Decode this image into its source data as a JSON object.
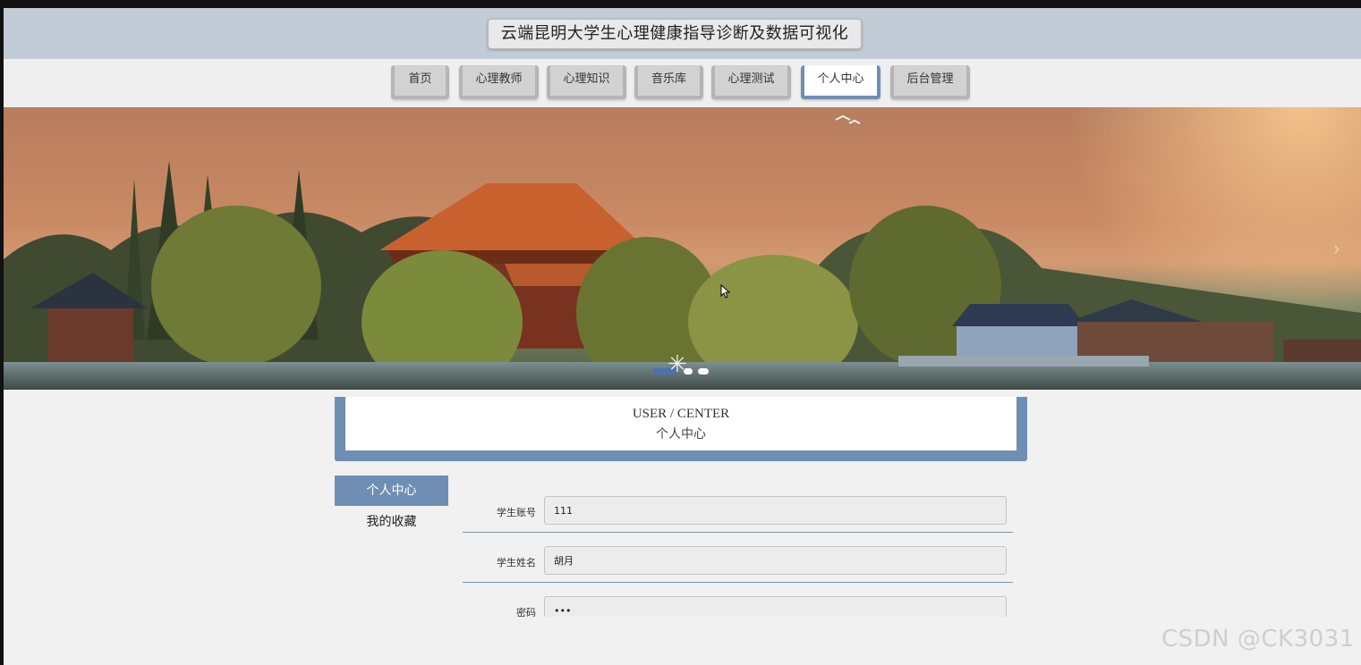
{
  "header": {
    "title": "云端昆明大学生心理健康指导诊断及数据可视化"
  },
  "nav": {
    "items": [
      {
        "label": "首页"
      },
      {
        "label": "心理教师"
      },
      {
        "label": "心理知识"
      },
      {
        "label": "音乐库"
      },
      {
        "label": "心理测试"
      },
      {
        "label": "个人中心"
      },
      {
        "label": "后台管理"
      }
    ],
    "active": "个人中心"
  },
  "banner": {
    "icons": {
      "next": "chevron-right-icon",
      "loader": "spinner-icon"
    }
  },
  "section": {
    "title_en": "USER / CENTER",
    "title_cn": "个人中心"
  },
  "sidebar": {
    "items": [
      {
        "label": "个人中心"
      },
      {
        "label": "我的收藏"
      }
    ],
    "active": "个人中心"
  },
  "form": {
    "fields": [
      {
        "label": "学生账号",
        "value": "111"
      },
      {
        "label": "学生姓名",
        "value": "胡月"
      },
      {
        "label": "密码",
        "value": "•••"
      }
    ]
  },
  "watermark": "CSDN @CK3031",
  "colors": {
    "accent": "#6f8eb4",
    "header_bg": "#c2ccd6",
    "nav_btn": "#d2d2d2"
  }
}
